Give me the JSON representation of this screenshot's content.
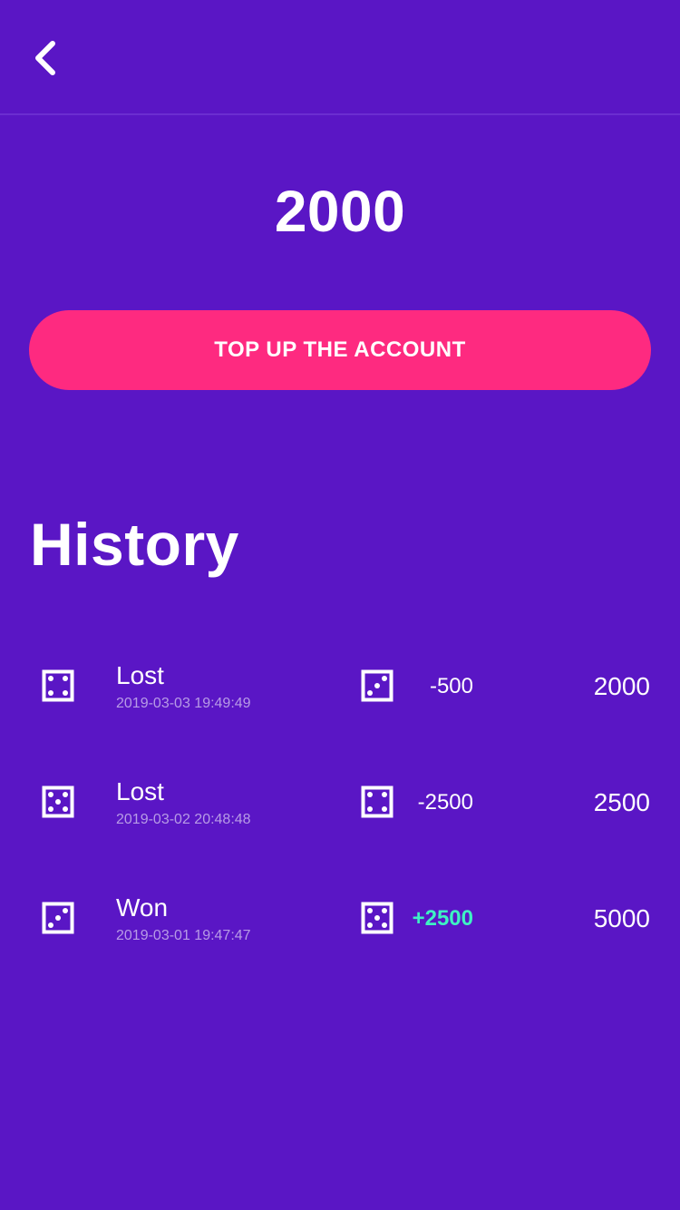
{
  "header": {
    "back_icon": "chevron-left-icon"
  },
  "balance": {
    "value": "2000"
  },
  "topup": {
    "label": "TOP UP THE ACCOUNT",
    "color": "#fe2a80"
  },
  "history": {
    "title": "History",
    "items": [
      {
        "status": "Lost",
        "timestamp": "2019-03-03 19:49:49",
        "change": "-500",
        "total": "2000",
        "left_die": 4,
        "right_die": 3,
        "left_icon": "dice-four-icon",
        "right_icon": "dice-three-icon"
      },
      {
        "status": "Lost",
        "timestamp": "2019-03-02 20:48:48",
        "change": "-2500",
        "total": "2500",
        "left_die": 5,
        "right_die": 4,
        "left_icon": "dice-five-icon",
        "right_icon": "dice-four-icon"
      },
      {
        "status": "Won",
        "timestamp": "2019-03-01 19:47:47",
        "change": "+2500",
        "total": "5000",
        "left_die": 3,
        "right_die": 5,
        "left_icon": "dice-three-icon",
        "right_icon": "dice-five-icon",
        "win": true
      }
    ]
  },
  "colors": {
    "background": "#5a16c5",
    "win": "#3ef2c3",
    "timestamp": "#b79be6"
  }
}
